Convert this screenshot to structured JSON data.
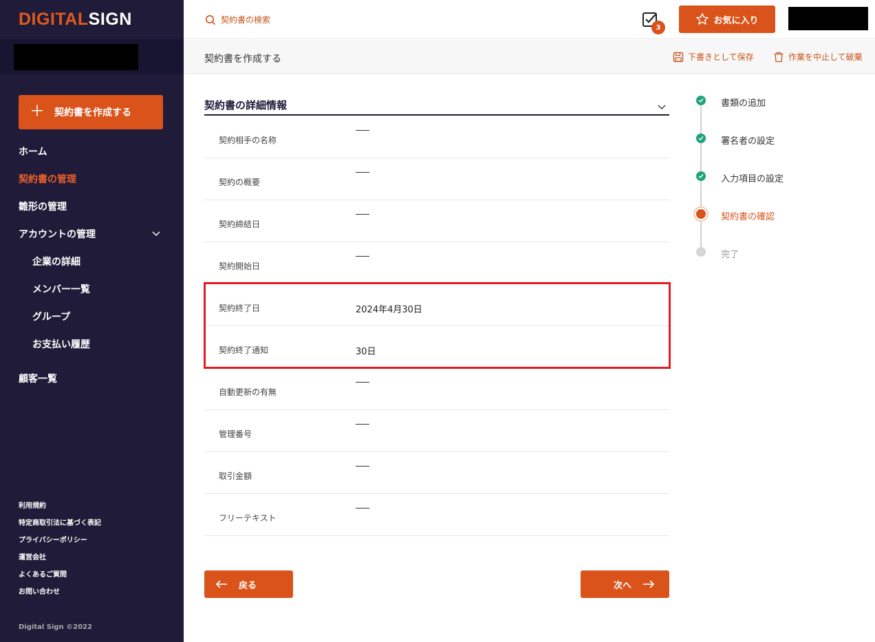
{
  "brand": {
    "logo_part1": "DIGITAL",
    "logo_part2": "SIGN"
  },
  "sidebar": {
    "create_button": "契約書を作成する",
    "nav": [
      {
        "label": "ホーム"
      },
      {
        "label": "契約書の管理",
        "active": true
      },
      {
        "label": "雛形の管理"
      },
      {
        "label": "アカウントの管理"
      }
    ],
    "sub_nav": [
      {
        "label": "企業の詳細"
      },
      {
        "label": "メンバー一覧"
      },
      {
        "label": "グループ"
      },
      {
        "label": "お支払い履歴"
      }
    ],
    "customers": "顧客一覧",
    "footer_links": [
      "利用規約",
      "特定商取引法に基づく表記",
      "プライバシーポリシー",
      "運営会社",
      "よくあるご質問",
      "お問い合わせ"
    ],
    "copyright": "Digital Sign ©2022"
  },
  "header": {
    "search_placeholder": "契約書の検索",
    "task_count": "3",
    "favorites_label": "お気に入り"
  },
  "subbar": {
    "title": "契約書を作成する",
    "save_draft": "下書きとして保存",
    "discard": "作業を中止して破棄"
  },
  "details": {
    "title": "契約書の詳細情報",
    "rows": [
      {
        "label": "契約相手の名称",
        "value": ""
      },
      {
        "label": "契約の概要",
        "value": ""
      },
      {
        "label": "契約締結日",
        "value": ""
      },
      {
        "label": "契約開始日",
        "value": ""
      },
      {
        "label": "契約終了日",
        "value": "2024年4月30日"
      },
      {
        "label": "契約終了通知",
        "value": "30日"
      },
      {
        "label": "自動更新の有無",
        "value": ""
      },
      {
        "label": "管理番号",
        "value": ""
      },
      {
        "label": "取引金額",
        "value": ""
      },
      {
        "label": "フリーテキスト",
        "value": ""
      }
    ]
  },
  "buttons": {
    "back": "戻る",
    "next": "次へ"
  },
  "steps": [
    {
      "label": "書類の追加",
      "status": "done"
    },
    {
      "label": "署名者の設定",
      "status": "done"
    },
    {
      "label": "入力項目の設定",
      "status": "done"
    },
    {
      "label": "契約書の確認",
      "status": "current"
    },
    {
      "label": "完了",
      "status": "pending"
    }
  ],
  "colors": {
    "accent": "#d9531a",
    "sidebar": "#1f1b38",
    "success": "#1fa37a",
    "highlight": "#e31b23"
  }
}
